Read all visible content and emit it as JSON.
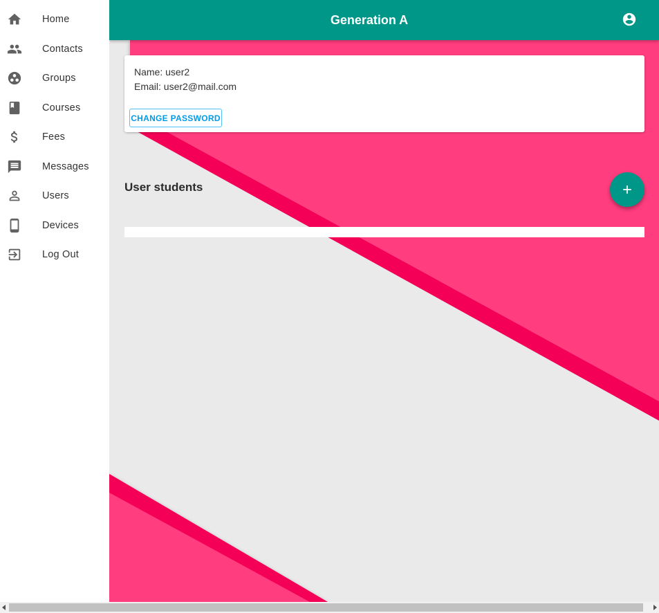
{
  "app": {
    "title": "Generation A",
    "accent_color": "#009688",
    "decor_colors": [
      "#ff3d7f",
      "#f50057"
    ],
    "account_icon": "account-circle-icon"
  },
  "sidebar": {
    "items": [
      {
        "label": "Home",
        "icon": "home-icon"
      },
      {
        "label": "Contacts",
        "icon": "people-icon"
      },
      {
        "label": "Groups",
        "icon": "group-work-icon"
      },
      {
        "label": "Courses",
        "icon": "book-icon"
      },
      {
        "label": "Fees",
        "icon": "dollar-icon"
      },
      {
        "label": "Messages",
        "icon": "message-icon"
      },
      {
        "label": "Users",
        "icon": "person-icon"
      },
      {
        "label": "Devices",
        "icon": "phone-device-icon"
      },
      {
        "label": "Log Out",
        "icon": "logout-icon"
      }
    ]
  },
  "profile": {
    "name_line": "Name: user2",
    "email_line": "Email: user2@mail.com",
    "change_password_label": "CHANGE PASSWORD"
  },
  "students": {
    "title": "User students",
    "add_icon": "plus-icon"
  }
}
